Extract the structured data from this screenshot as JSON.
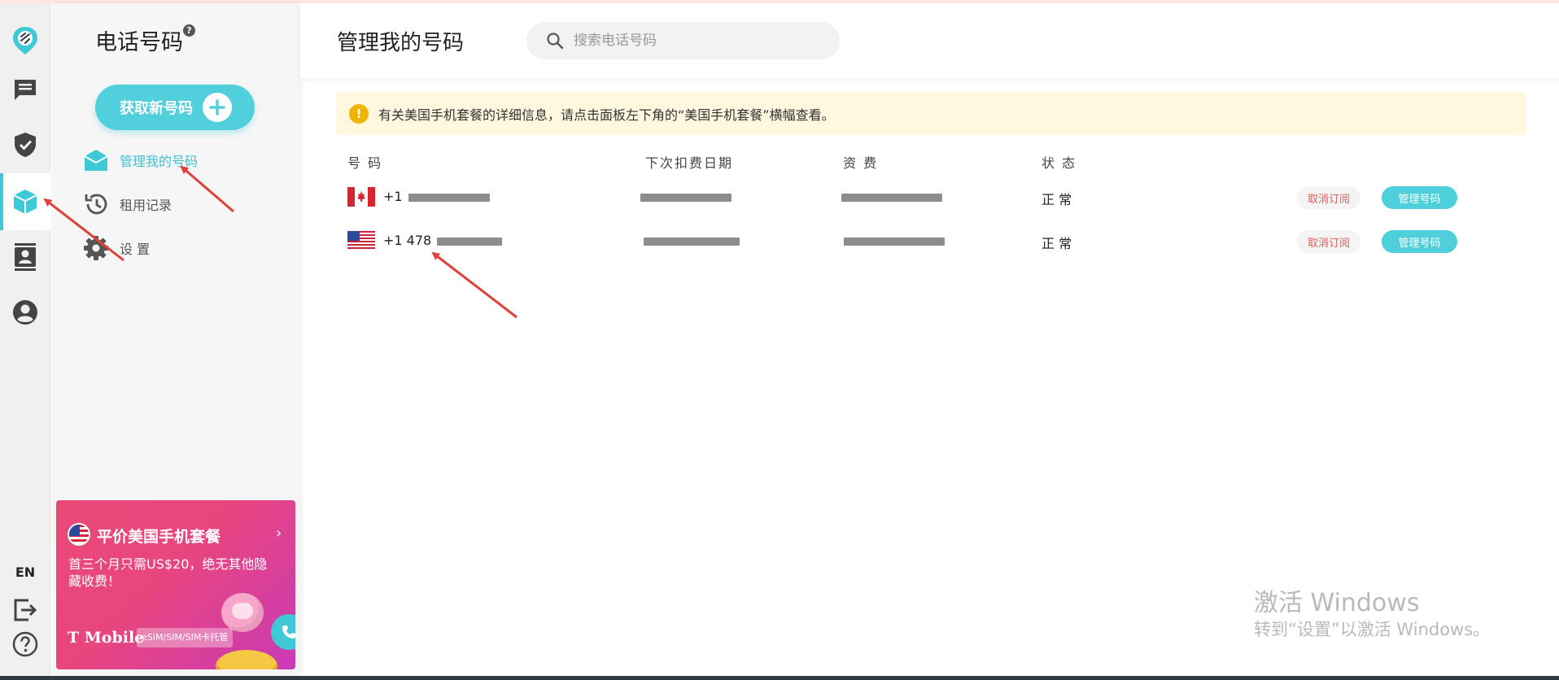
{
  "rail": {
    "items": [
      "logo",
      "messages",
      "security",
      "numbers",
      "contacts",
      "account"
    ],
    "lang": "EN"
  },
  "panel": {
    "title": "电话号码",
    "help": "?",
    "get_number_label": "获取新号码",
    "nav": [
      {
        "label": "管理我的号码",
        "icon": "sim-card-icon",
        "active": true
      },
      {
        "label": "租用记录",
        "icon": "history-icon",
        "active": false
      },
      {
        "label": "设 置",
        "icon": "gear-icon",
        "active": false
      }
    ],
    "promo": {
      "title": "平价美国手机套餐",
      "chevron": "›",
      "desc": "首三个月只需US$20，绝无其他隐藏收费！",
      "brand": "T Mobile",
      "tag": "eSIM/SIM/SIM卡托管"
    }
  },
  "main": {
    "title": "管理我的号码",
    "search_placeholder": "搜索电话号码",
    "notice": "有关美国手机套餐的详细信息，请点击面板左下角的“美国手机套餐”横幅查看。",
    "notice_icon": "!",
    "columns": [
      "号 码",
      "下次扣费日期",
      "资 费",
      "状 态"
    ],
    "rows": [
      {
        "country": "CA",
        "number_prefix": "+1",
        "status": "正 常",
        "unsubscribe": "取消订阅",
        "manage": "管理号码"
      },
      {
        "country": "US",
        "number_prefix": "+1 478",
        "status": "正 常",
        "unsubscribe": "取消订阅",
        "manage": "管理号码"
      }
    ]
  },
  "watermark": {
    "line1": "激活 Windows",
    "line2": "转到“设置”以激活 Windows。"
  },
  "colors": {
    "accent": "#3fc8d6",
    "notice_bg": "#fff7de",
    "unsubscribe_text": "#e25b5b",
    "annotation_arrow": "#e0403a"
  }
}
